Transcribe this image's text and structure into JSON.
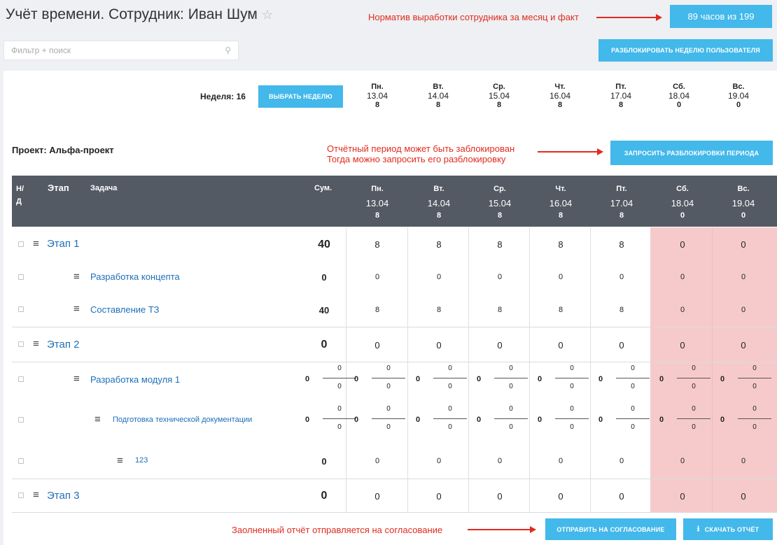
{
  "title": "Учёт времени. Сотрудник: Иван Шум",
  "star": "☆",
  "hours_button": "89 часов из 199",
  "notes": {
    "norm": "Норматив выработки сотрудника за месяц и факт",
    "blocked_1": "Отчётный период может быть заблокирован",
    "blocked_2": "Тогда можно запросить его разблокировку",
    "approval": "Заолненный отчёт отправляется на согласование"
  },
  "search": {
    "placeholder": "Фильтр + поиск",
    "icon": "search-icon"
  },
  "unlock_week_button": "Разблокировать неделю пользователя",
  "week": {
    "label": "Неделя: 16",
    "choose_button": "Выбрать неделю",
    "days": [
      {
        "name": "Пн.",
        "date": "13.04",
        "hours": "8"
      },
      {
        "name": "Вт.",
        "date": "14.04",
        "hours": "8"
      },
      {
        "name": "Ср.",
        "date": "15.04",
        "hours": "8"
      },
      {
        "name": "Чт.",
        "date": "16.04",
        "hours": "8"
      },
      {
        "name": "Пт.",
        "date": "17.04",
        "hours": "8"
      },
      {
        "name": "Сб.",
        "date": "18.04",
        "hours": "0"
      },
      {
        "name": "Вс.",
        "date": "19.04",
        "hours": "0"
      }
    ]
  },
  "project": {
    "label": "Проект: Альфа-проект",
    "request_unlock_button": "Запросить разблокировки периода"
  },
  "table": {
    "headers": {
      "nd_1": "Н/",
      "nd_2": "Д",
      "stage": "Этап",
      "task": "Задача",
      "sum": "Сум."
    },
    "rows": [
      {
        "type": "stage",
        "name": "Этап 1",
        "sum": "40",
        "values": [
          "8",
          "8",
          "8",
          "8",
          "8",
          "0",
          "0"
        ]
      },
      {
        "type": "task",
        "name": "Разработка концепта",
        "sum": "0",
        "values": [
          "0",
          "0",
          "0",
          "0",
          "0",
          "0",
          "0"
        ]
      },
      {
        "type": "task",
        "name": "Составление ТЗ",
        "sum": "40",
        "values": [
          "8",
          "8",
          "8",
          "8",
          "8",
          "0",
          "0"
        ]
      },
      {
        "type": "stage",
        "name": "Этап 2",
        "sum": "0",
        "values": [
          "0",
          "0",
          "0",
          "0",
          "0",
          "0",
          "0"
        ]
      },
      {
        "type": "task-frac",
        "name": "Разработка модуля 1",
        "sum": {
          "l": "0",
          "t": "0",
          "b": "0"
        },
        "values": [
          [
            "0",
            "0",
            "0"
          ],
          [
            "0",
            "0",
            "0"
          ],
          [
            "0",
            "0",
            "0"
          ],
          [
            "0",
            "0",
            "0"
          ],
          [
            "0",
            "0",
            "0"
          ],
          [
            "0",
            "0",
            "0"
          ],
          [
            "0",
            "0",
            "0"
          ]
        ]
      },
      {
        "type": "subtask-frac",
        "name": "Подготовка технической документации",
        "sum": {
          "l": "0",
          "t": "0",
          "b": "0"
        },
        "values": [
          [
            "0",
            "0",
            "0"
          ],
          [
            "0",
            "0",
            "0"
          ],
          [
            "0",
            "0",
            "0"
          ],
          [
            "0",
            "0",
            "0"
          ],
          [
            "0",
            "0",
            "0"
          ],
          [
            "0",
            "0",
            "0"
          ],
          [
            "0",
            "0",
            "0"
          ]
        ]
      },
      {
        "type": "subsubtask",
        "name": "123",
        "sum": "0",
        "values": [
          "0",
          "0",
          "0",
          "0",
          "0",
          "0",
          "0"
        ]
      },
      {
        "type": "stage",
        "name": "Этап 3",
        "sum": "0",
        "values": [
          "0",
          "0",
          "0",
          "0",
          "0",
          "0",
          "0"
        ]
      }
    ]
  },
  "footer": {
    "send_button": "Отправить на согласование",
    "download_button": "Скачать отчёт",
    "download_icon": "download-icon"
  },
  "colors": {
    "accent": "#43b8ea",
    "header_bg": "#535a63",
    "weekend_bg": "#f6caca",
    "note_red": "#e02b1f",
    "link": "#1e6fb8"
  }
}
